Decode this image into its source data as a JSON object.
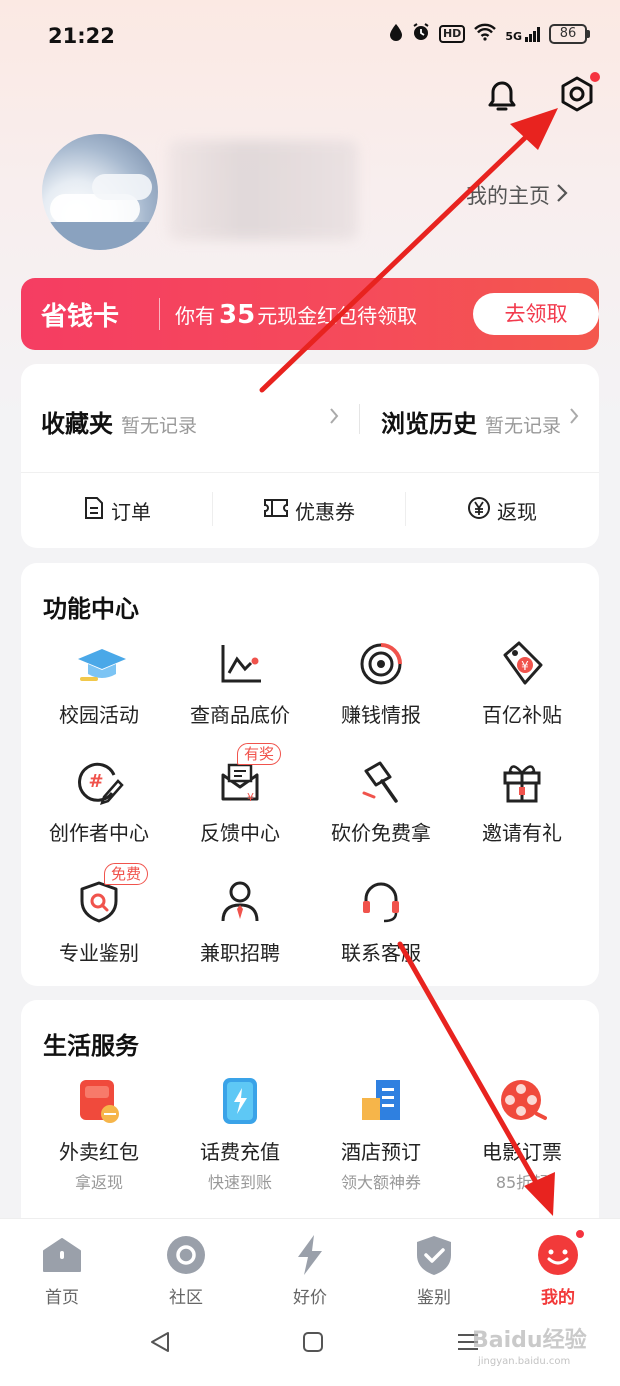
{
  "status_bar": {
    "time": "21:22",
    "hd": "HD",
    "network": "5G",
    "battery": "86"
  },
  "header": {
    "bell_icon": "bell-icon",
    "settings_icon": "gear-icon"
  },
  "profile": {
    "homepage_link": "我的主页"
  },
  "saving_card": {
    "title": "省钱卡",
    "text_prefix": "你有",
    "amount": "35",
    "text_suffix": "元现金红包待领取",
    "button": "去领取"
  },
  "favorites": {
    "collect_title": "收藏夹",
    "collect_sub": "暂无记录",
    "history_title": "浏览历史",
    "history_sub": "暂无记录"
  },
  "quick_links": [
    {
      "label": "订单",
      "icon": "order-icon"
    },
    {
      "label": "优惠券",
      "icon": "coupon-icon"
    },
    {
      "label": "返现",
      "icon": "yuan-icon"
    }
  ],
  "function_center": {
    "title": "功能中心",
    "items": [
      {
        "label": "校园活动",
        "icon": "graduation-cap-icon"
      },
      {
        "label": "查商品底价",
        "icon": "price-chart-icon"
      },
      {
        "label": "赚钱情报",
        "icon": "target-icon"
      },
      {
        "label": "百亿补贴",
        "icon": "price-tag-icon"
      },
      {
        "label": "创作者中心",
        "icon": "creator-icon"
      },
      {
        "label": "反馈中心",
        "icon": "feedback-icon",
        "badge": "有奖"
      },
      {
        "label": "砍价免费拿",
        "icon": "axe-icon"
      },
      {
        "label": "邀请有礼",
        "icon": "gift-icon"
      },
      {
        "label": "专业鉴别",
        "icon": "shield-search-icon",
        "badge": "免费"
      },
      {
        "label": "兼职招聘",
        "icon": "person-tie-icon"
      },
      {
        "label": "联系客服",
        "icon": "headset-icon"
      }
    ]
  },
  "life_services": {
    "title": "生活服务",
    "items": [
      {
        "label": "外卖红包",
        "sub": "拿返现",
        "icon": "takeout-icon"
      },
      {
        "label": "话费充值",
        "sub": "快速到账",
        "icon": "phone-bolt-icon"
      },
      {
        "label": "酒店预订",
        "sub": "领大额神券",
        "icon": "hotel-icon"
      },
      {
        "label": "电影订票",
        "sub": "85折起",
        "icon": "film-reel-icon"
      }
    ]
  },
  "bottom_nav": [
    {
      "label": "首页",
      "icon": "home-icon"
    },
    {
      "label": "社区",
      "icon": "community-icon"
    },
    {
      "label": "好价",
      "icon": "lightning-icon"
    },
    {
      "label": "鉴别",
      "icon": "shield-check-icon"
    },
    {
      "label": "我的",
      "icon": "profile-face-icon",
      "active": true
    }
  ],
  "watermark": {
    "text": "Baidu经验",
    "sub": "jingyan.baidu.com"
  },
  "colors": {
    "accent": "#f23a3a",
    "card_gradient_start": "#f53d62",
    "card_gradient_end": "#f4574d",
    "arrow": "#e8231f"
  }
}
